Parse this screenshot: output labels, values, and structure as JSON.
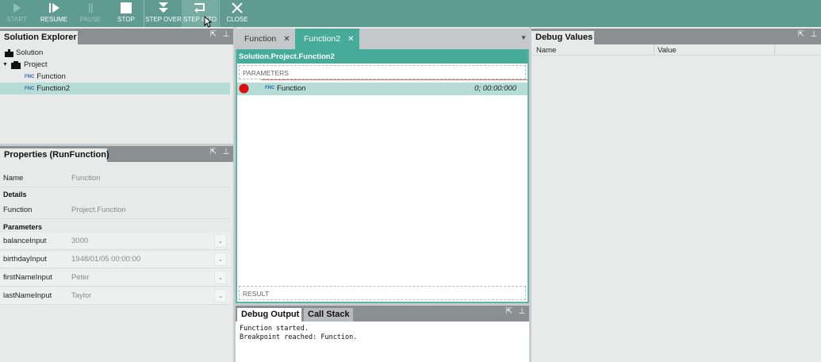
{
  "toolbar": {
    "buttons": [
      {
        "label": "START",
        "icon": "play-icon",
        "enabled": false
      },
      {
        "label": "RESUME",
        "icon": "resume-icon",
        "enabled": true
      },
      {
        "label": "PAUSE",
        "icon": "pause-icon",
        "enabled": false
      },
      {
        "label": "STOP",
        "icon": "stop-icon",
        "enabled": true
      },
      {
        "label": "STEP OVER",
        "icon": "step-over-icon",
        "enabled": true
      },
      {
        "label": "STEP INTO",
        "icon": "step-into-icon",
        "enabled": true
      },
      {
        "label": "CLOSE",
        "icon": "close-icon",
        "enabled": true
      }
    ]
  },
  "solution_explorer": {
    "title": "Solution Explorer",
    "tree": {
      "solution": "Solution",
      "project": "Project",
      "items": [
        {
          "badge": "FNC",
          "label": "Function"
        },
        {
          "badge": "FNC",
          "label": "Function2"
        }
      ]
    }
  },
  "properties": {
    "title": "Properties (RunFunction)",
    "name_label": "Name",
    "name_value": "Function",
    "details_heading": "Details",
    "function_label": "Function",
    "function_value": "Project.Function",
    "parameters_heading": "Parameters",
    "params": [
      {
        "name": "balanceInput",
        "value": "3000"
      },
      {
        "name": "birthdayInput",
        "value": "1948/01/05 00:00:00"
      },
      {
        "name": "firstNameInput",
        "value": "Peter"
      },
      {
        "name": "lastNameInput",
        "value": "Taylor"
      }
    ]
  },
  "editor": {
    "tabs": [
      {
        "label": "Function",
        "active": false
      },
      {
        "label": "Function2",
        "active": true
      }
    ],
    "breadcrumb": "Solution.Project.Function2",
    "parameters_label": "PARAMETERS",
    "result_label": "RESULT",
    "step": {
      "badge": "FNC",
      "label": "Function",
      "time": "0; 00:00:000"
    }
  },
  "debug_output": {
    "tabs": [
      "Debug Output",
      "Call Stack"
    ],
    "lines": [
      "Function started.",
      "Breakpoint reached: Function."
    ]
  },
  "debug_values": {
    "title": "Debug Values",
    "columns": [
      "Name",
      "Value"
    ]
  },
  "colors": {
    "toolbar": "#5f9b90",
    "accent": "#46ac99",
    "selection": "#b5dcd5",
    "breakpoint": "#d81010"
  }
}
